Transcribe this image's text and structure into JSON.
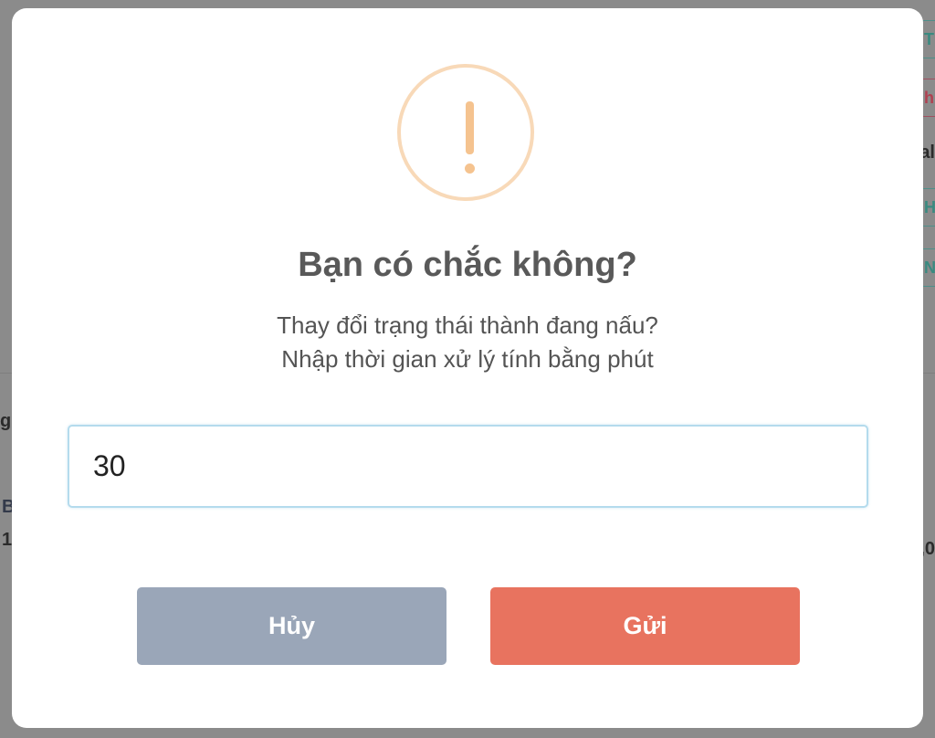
{
  "modal": {
    "icon": "warning-icon",
    "title": "Bạn có chắc không?",
    "text_line1": "Thay đổi trạng thái thành đang nấu?",
    "text_line2": "Nhập thời gian xử lý tính bằng phút",
    "input_value": "30",
    "cancel_label": "Hủy",
    "submit_label": "Gửi"
  },
  "colors": {
    "cancel_button": "#9aa6b8",
    "submit_button": "#e8735f",
    "warning_icon": "#f5c38f",
    "overlay": "#8b8b8b"
  },
  "background": {
    "right_fragments": [
      "T",
      "h",
      "al",
      "H",
      "N",
      ",0"
    ],
    "left_fragments": [
      "g",
      "B",
      "1"
    ]
  }
}
